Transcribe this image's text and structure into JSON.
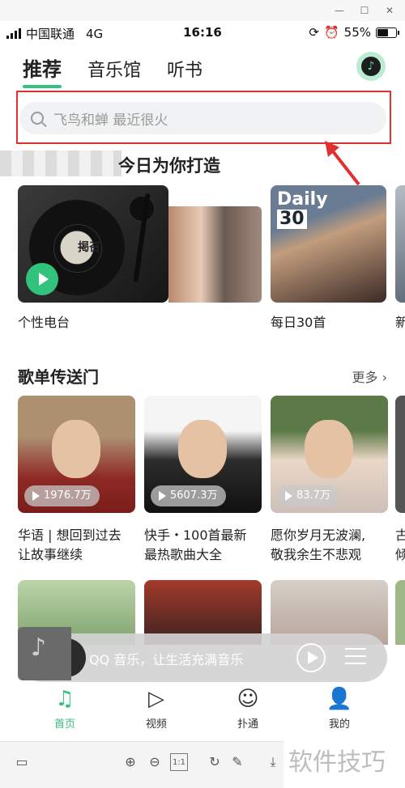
{
  "status": {
    "carrier": "中国联通",
    "network": "4G",
    "time": "16:16",
    "battery": "55%",
    "battery_level": 0.55
  },
  "tabs": [
    {
      "label": "推荐",
      "active": true
    },
    {
      "label": "音乐馆",
      "active": false
    },
    {
      "label": "听书",
      "active": false
    }
  ],
  "search": {
    "placeholder": "飞鸟和蝉 最近很火"
  },
  "recommend": {
    "title": "今日为你打造",
    "vinyl_text": "掲召",
    "daily_word": "Daily",
    "daily_num": "30",
    "cards": [
      {
        "label": "个性电台"
      },
      {
        "label": "每日30首"
      },
      {
        "label": "新"
      }
    ]
  },
  "playlist_section": {
    "title": "歌单传送门",
    "more": "更多",
    "items": [
      {
        "count": "1976.7万",
        "line1": "华语 | 想回到过去",
        "line2": "让故事继续"
      },
      {
        "count": "5607.3万",
        "line1": "快手・100首最新",
        "line2": "最热歌曲大全"
      },
      {
        "count": "83.7万",
        "line1": "愿你岁月无波澜,",
        "line2": "敬我余生不悲观"
      },
      {
        "count": "",
        "line1": "古",
        "line2": "倾"
      }
    ]
  },
  "player": {
    "text": "QQ 音乐，让生活充满音乐"
  },
  "nav": [
    {
      "label": "首页",
      "icon": "music-note-icon",
      "active": true
    },
    {
      "label": "视频",
      "icon": "video-play-icon",
      "active": false
    },
    {
      "label": "扑通",
      "icon": "chat-face-icon",
      "active": false
    },
    {
      "label": "我的",
      "icon": "person-icon",
      "active": false
    }
  ],
  "toolbar": {
    "zoom_fit": "1:1"
  },
  "watermark": "软件技巧",
  "colors": {
    "accent": "#31c27c",
    "highlight_box": "#e03030"
  }
}
